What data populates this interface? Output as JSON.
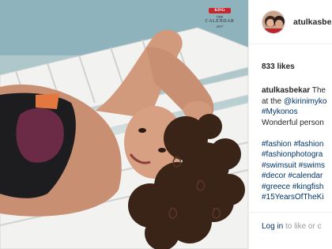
{
  "photo": {
    "watermark": {
      "brand": "KING",
      "line1": "THE",
      "line2": "CALENDAR",
      "year": "2017"
    }
  },
  "panel": {
    "username": "atulkasbekar",
    "likes": "833 likes",
    "caption": {
      "username": "atulkasbekar",
      "line1_tail": " The",
      "line2_a": "at the ",
      "line2_mention": "@kirinimyko",
      "line3_tag": "#Mykonos",
      "line4": "Wonderful person",
      "hashtag_lines": [
        [
          "#fashion",
          "#fashion"
        ],
        [
          "#fashionphotogra"
        ],
        [
          "#swimsuit",
          "#swims"
        ],
        [
          "#decor",
          "#calendar"
        ],
        [
          "#greece",
          "#kingfish"
        ],
        [
          "#15YearsOfTheKi"
        ]
      ]
    },
    "login": {
      "link": "Log in",
      "rest": " to like or c"
    }
  },
  "colors": {
    "link": "#003569",
    "text": "#262626",
    "muted": "#999999",
    "border": "#efefef"
  }
}
